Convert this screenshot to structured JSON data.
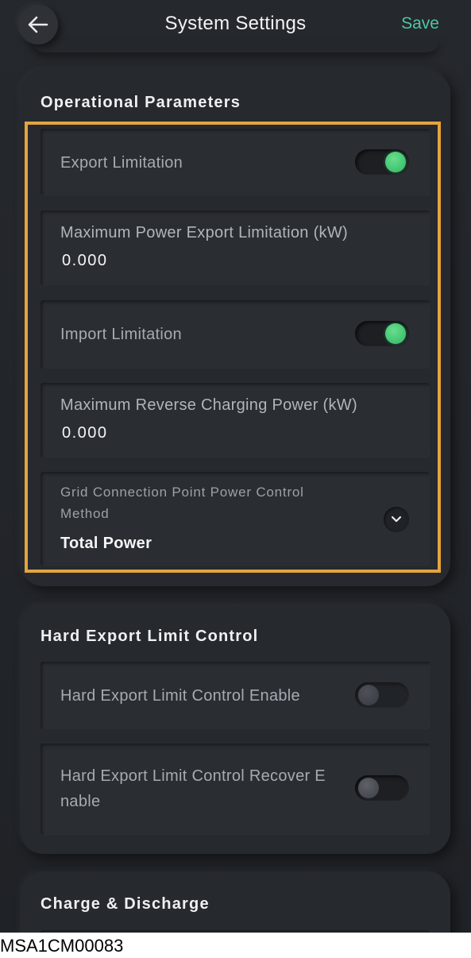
{
  "header": {
    "title": "System Settings",
    "save_label": "Save",
    "back_icon": "arrow-left-icon"
  },
  "operational": {
    "title": "Operational Parameters",
    "export_limitation": {
      "label": "Export Limitation",
      "enabled": true
    },
    "max_export": {
      "label": "Maximum Power Export Limitation (kW)",
      "value": "0.000"
    },
    "import_limitation": {
      "label": "Import Limitation",
      "enabled": true
    },
    "max_reverse": {
      "label": "Maximum Reverse Charging Power (kW)",
      "value": "0.000"
    },
    "grid_control": {
      "label_line1": "Grid Connection Point Power Control",
      "label_line2": "Method",
      "value": "Total Power",
      "icon": "chevron-down-icon"
    }
  },
  "hard_export": {
    "title": "Hard Export Limit Control",
    "enable": {
      "label": "Hard Export Limit Control Enable",
      "enabled": false
    },
    "recover": {
      "label_line1": "Hard Export Limit Control Recover E",
      "label_line2": "nable",
      "enabled": false
    }
  },
  "charge": {
    "title": "Charge & Discharge"
  },
  "caption": "MSA1CM00083",
  "colors": {
    "accent": "#4fc6a2",
    "highlight": "#e5a43c",
    "toggle_on": "#3cc96e",
    "background": "#24272b"
  }
}
